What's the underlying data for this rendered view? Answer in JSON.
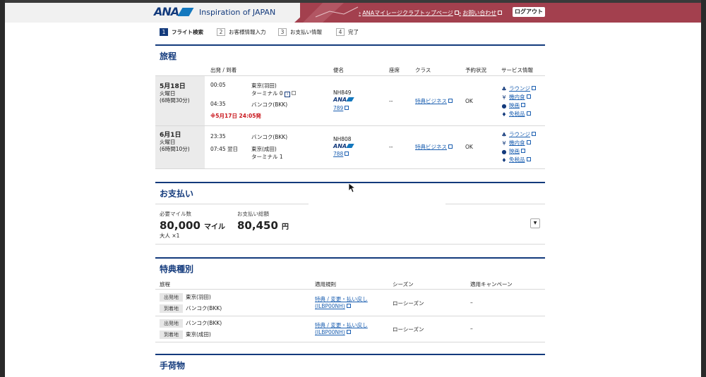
{
  "header": {
    "logo_text": "ANA",
    "tagline": "Inspiration of JAPAN",
    "mileage_link": "ANAマイレージクラブトップページ",
    "contact_link": "お問い合わせ",
    "logout": "ログアウト"
  },
  "steps": [
    {
      "num": "1",
      "label": "フライト検索"
    },
    {
      "num": "2",
      "label": "お客様情報入力"
    },
    {
      "num": "3",
      "label": "お支払い情報"
    },
    {
      "num": "4",
      "label": "完了"
    }
  ],
  "itinerary": {
    "title": "旅程",
    "headers": [
      "出発 / 到着",
      "便名",
      "座席",
      "クラス",
      "予約状況",
      "サービス情報"
    ],
    "rows": [
      {
        "date": "5月18日",
        "weekday": "火曜日",
        "duration": "(6時間30分)",
        "dep_time": "00:05",
        "dep_place": "東京(羽田)",
        "dep_terminal": "ターミナル 0",
        "arr_time": "04:35",
        "arr_place": "バンコク(BKK)",
        "note": "※5月17日 24:05発",
        "flight": "NH849",
        "airline": "ANA",
        "aircraft": "789",
        "seat": "--",
        "class": "特典ビジネス",
        "status": "OK",
        "services": [
          "ラウンジ",
          "機内食",
          "映画",
          "免税品"
        ]
      },
      {
        "date": "6月1日",
        "weekday": "火曜日",
        "duration": "(6時間10分)",
        "dep_time": "23:35",
        "dep_place": "バンコク(BKK)",
        "arr_time": "07:45 翌日",
        "arr_place": "東京(成田)",
        "arr_terminal": "ターミナル 1",
        "flight": "NH808",
        "airline": "ANA",
        "aircraft": "788",
        "seat": "--",
        "class": "特典ビジネス",
        "status": "OK",
        "services": [
          "ラウンジ",
          "機内食",
          "映画",
          "免税品"
        ]
      }
    ]
  },
  "payment": {
    "title": "お支払い",
    "miles_label": "必要マイル数",
    "miles_value": "80,000",
    "miles_unit": "マイル",
    "pax": "大人 ×1",
    "total_label": "お支払い総額",
    "total_value": "80,450",
    "total_unit": "円"
  },
  "award": {
    "title": "特典種別",
    "headers": [
      "旅程",
      "適用規則",
      "シーズン",
      "適用キャンペーン"
    ],
    "rows": [
      {
        "dep_label": "出発地",
        "dep": "東京(羽田)",
        "arr_label": "到着地",
        "arr": "バンコク(BKK)",
        "rule": "特典 / 変更・払い戻し",
        "rule_code": "(ILBP00NH)",
        "season": "ローシーズン",
        "campaign": "–"
      },
      {
        "dep_label": "出発地",
        "dep": "バンコク(BKK)",
        "arr_label": "到着地",
        "arr": "東京(成田)",
        "rule": "特典 / 変更・払い戻し",
        "rule_code": "(ILBP00NH)",
        "season": "ローシーズン",
        "campaign": "–"
      }
    ]
  },
  "baggage": {
    "title": "手荷物"
  },
  "colors": {
    "brand": "#133a7c",
    "header_red": "#a3404e",
    "link": "#1a5eb0",
    "alert": "#c9161c"
  }
}
